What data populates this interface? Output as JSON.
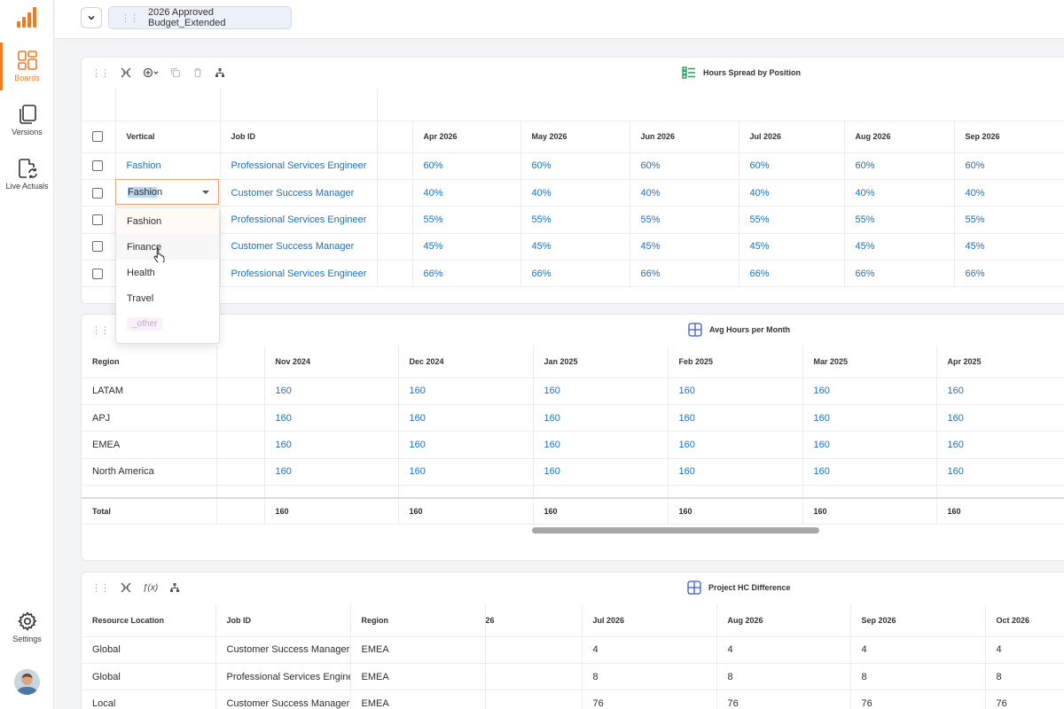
{
  "colors": {
    "accent": "#f47a1f",
    "link": "#1d6fb8",
    "title_icon": "#2aa05a",
    "grid_icon": "#3a5bd0"
  },
  "sidebar": {
    "items": [
      {
        "label": "Boards",
        "icon": "boards-icon",
        "active": true
      },
      {
        "label": "Versions",
        "icon": "versions-icon",
        "active": false
      },
      {
        "label": "Live Actuals",
        "icon": "live-actuals-icon",
        "active": false
      }
    ],
    "settings_label": "Settings"
  },
  "topbar": {
    "version_name": "2026 Approved Budget_Extended"
  },
  "panel1": {
    "title": "Hours Spread by Position",
    "columns": [
      "Vertical",
      "Job ID",
      "",
      "Apr 2026",
      "May 2026",
      "Jun 2026",
      "Jul 2026",
      "Aug 2026",
      "Sep 2026"
    ],
    "rows": [
      {
        "vertical": "Fashion",
        "job": "Professional Services Engineer",
        "values": [
          "60%",
          "60%",
          "60%",
          "60%",
          "60%",
          "60%"
        ]
      },
      {
        "vertical": "",
        "job": "Customer Success Manager",
        "values": [
          "40%",
          "40%",
          "40%",
          "40%",
          "40%",
          "40%"
        ]
      },
      {
        "vertical": "",
        "job": "Professional Services Engineer",
        "values": [
          "55%",
          "55%",
          "55%",
          "55%",
          "55%",
          "55%"
        ]
      },
      {
        "vertical": "",
        "job": "Customer Success Manager",
        "values": [
          "45%",
          "45%",
          "45%",
          "45%",
          "45%",
          "45%"
        ]
      },
      {
        "vertical": "",
        "job": "Professional Services Engineer",
        "values": [
          "66%",
          "66%",
          "66%",
          "66%",
          "66%",
          "66%"
        ]
      }
    ],
    "editor": {
      "text_selected": "Fashio",
      "text_rest": "n"
    },
    "dropdown_options": [
      "Fashion",
      "Finance",
      "Health",
      "Travel",
      "_other"
    ]
  },
  "panel2": {
    "title": "Avg Hours per Month",
    "columns": [
      "Region",
      "",
      "Nov 2024",
      "Dec 2024",
      "Jan 2025",
      "Feb 2025",
      "Mar 2025",
      "Apr 2025"
    ],
    "rows": [
      {
        "region": "LATAM",
        "values": [
          "160",
          "160",
          "160",
          "160",
          "160",
          "160"
        ]
      },
      {
        "region": "APJ",
        "values": [
          "160",
          "160",
          "160",
          "160",
          "160",
          "160"
        ]
      },
      {
        "region": "EMEA",
        "values": [
          "160",
          "160",
          "160",
          "160",
          "160",
          "160"
        ]
      },
      {
        "region": "North America",
        "values": [
          "160",
          "160",
          "160",
          "160",
          "160",
          "160"
        ]
      }
    ],
    "total": {
      "label": "Total",
      "values": [
        "160",
        "160",
        "160",
        "160",
        "160",
        "160"
      ]
    }
  },
  "panel3": {
    "title": "Project HC Difference",
    "columns": [
      "Resource Location",
      "Job ID",
      "Region",
      "26",
      "Jul 2026",
      "Aug 2026",
      "Sep 2026",
      "Oct 2026"
    ],
    "rows": [
      {
        "location": "Global",
        "job": "Customer Success Manager",
        "region": "EMEA",
        "values": [
          "4",
          "4",
          "4",
          "4"
        ]
      },
      {
        "location": "Global",
        "job": "Professional Services Engine",
        "region": "EMEA",
        "values": [
          "8",
          "8",
          "8",
          "8"
        ]
      },
      {
        "location": "Local",
        "job": "Customer Success Manager",
        "region": "EMEA",
        "values": [
          "76",
          "76",
          "76",
          "76"
        ]
      }
    ]
  }
}
